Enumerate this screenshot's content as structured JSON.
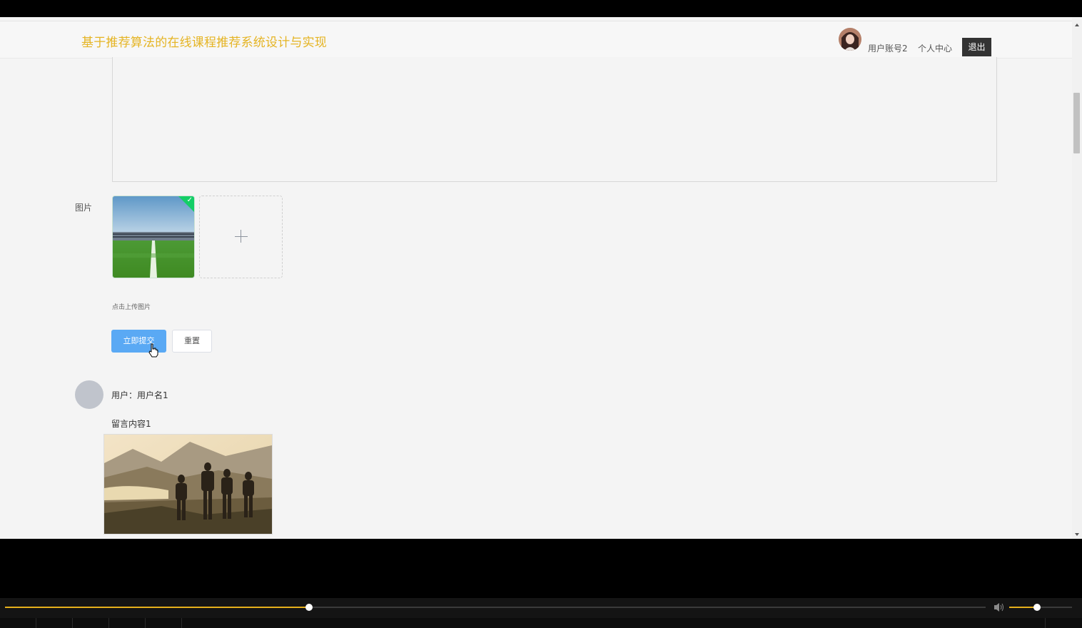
{
  "header": {
    "site_title": "基于推荐算法的在线课程推荐系统设计与实现",
    "user_account": "用户账号2",
    "personal_center": "个人中心",
    "logout": "退出"
  },
  "form": {
    "image_label": "图片",
    "upload_hint": "点击上传图片",
    "submit_label": "立即提交",
    "reset_label": "重置"
  },
  "comments": [
    {
      "user": "用户：用户名1",
      "content": "留言内容1"
    }
  ],
  "player": {
    "progress": 0.31,
    "volume": 0.44,
    "accent_color": "#e5b01c"
  },
  "colors": {
    "title": "#e5b423",
    "submit_button": "#5aa9f4",
    "logout_button": "#333333",
    "upload_success": "#13ce66"
  },
  "icons": {
    "upload": "plus-icon",
    "uploaded": "check-icon",
    "volume": "speaker-icon",
    "cursor": "hand-pointer-icon"
  }
}
